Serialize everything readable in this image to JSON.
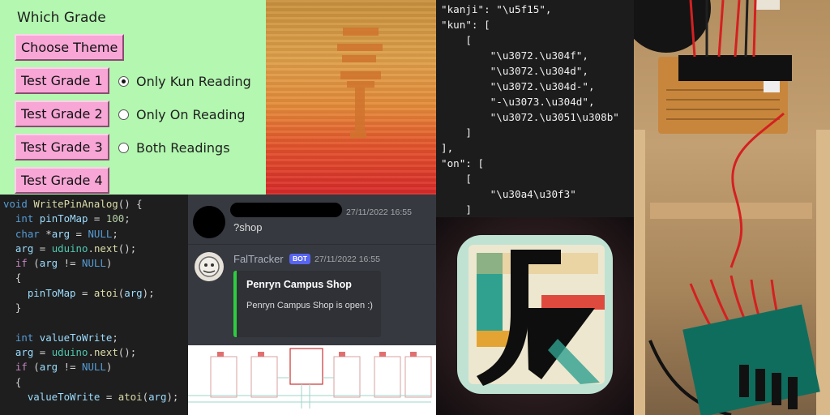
{
  "grade_panel": {
    "heading": "Which Grade",
    "buttons": [
      "Choose Theme",
      "Test Grade 1",
      "Test Grade 2",
      "Test Grade 3",
      "Test Grade 4"
    ],
    "radios": [
      {
        "label": "Only Kun Reading",
        "selected": true
      },
      {
        "label": "Only On Reading",
        "selected": false
      },
      {
        "label": "Both Readings",
        "selected": false
      }
    ],
    "bg_color": "#b3f7b0",
    "button_color": "#f7a6d6"
  },
  "json_panel": {
    "lines": [
      "\"kanji\": \"\\u5f15\",",
      "\"kun\": [",
      "    [",
      "        \"\\u3072.\\u304f\",",
      "        \"\\u3072.\\u304d\",",
      "        \"\\u3072.\\u304d-\",",
      "        \"-\\u3073.\\u304d\",",
      "        \"\\u3072.\\u3051\\u308b\"",
      "    ]",
      "],",
      "\"on\": [",
      "    [",
      "        \"\\u30a4\\u30f3\"",
      "    ]",
      "],"
    ]
  },
  "discord": {
    "message_time": "27/11/2022 16:55",
    "message_text": "?shop",
    "bot_name": "FalTracker",
    "bot_tag": "BOT",
    "bot_time": "27/11/2022 16:55",
    "embed_title": "Penryn Campus Shop",
    "embed_desc": "Penryn Campus Shop is open :)",
    "embed_color": "#2ecc40"
  },
  "code": {
    "fn_name": "WritePinAnalog",
    "var1": "pinToMap",
    "var1_value": "100",
    "var2": "valueToWrite"
  }
}
